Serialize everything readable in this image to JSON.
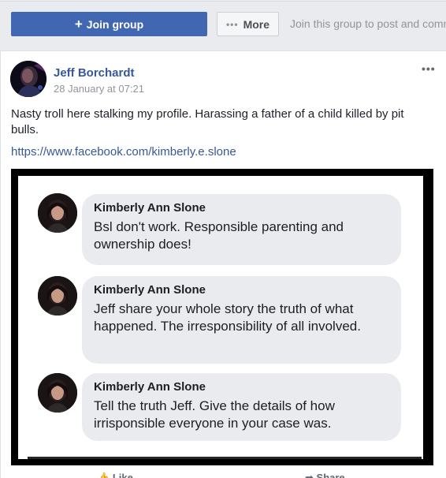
{
  "toolbar": {
    "join_label": "Join group",
    "more_label": "More",
    "join_hint": "Join this group to post and comm"
  },
  "post": {
    "author": "Jeff Borchardt",
    "time": "28 January at 07:21",
    "text": "Nasty troll here stalking my profile. Harassing a father of a child killed by pit bulls.",
    "link": "https://www.facebook.com/kimberly.e.slone",
    "screenshot_comments": [
      {
        "name": "Kimberly Ann Slone",
        "text": "Bsl don't work. Responsible parenting and ownership does!"
      },
      {
        "name": "Kimberly Ann Slone",
        "text": "Jeff share your whole story the truth of what happened. The irresponsibility of all involved."
      },
      {
        "name": "Kimberly Ann Slone",
        "text": "Tell the truth Jeff. Give the details of how irrisponsible everyone in your case was."
      }
    ]
  },
  "actions": {
    "like_label": "Like",
    "share_label": "Share"
  },
  "colors": {
    "brand": "#4267b2",
    "link": "#365899",
    "bubble": "#e9ebee"
  },
  "icons": [
    "plus-icon",
    "more-dots-icon",
    "options-icon",
    "like-icon",
    "share-icon"
  ]
}
